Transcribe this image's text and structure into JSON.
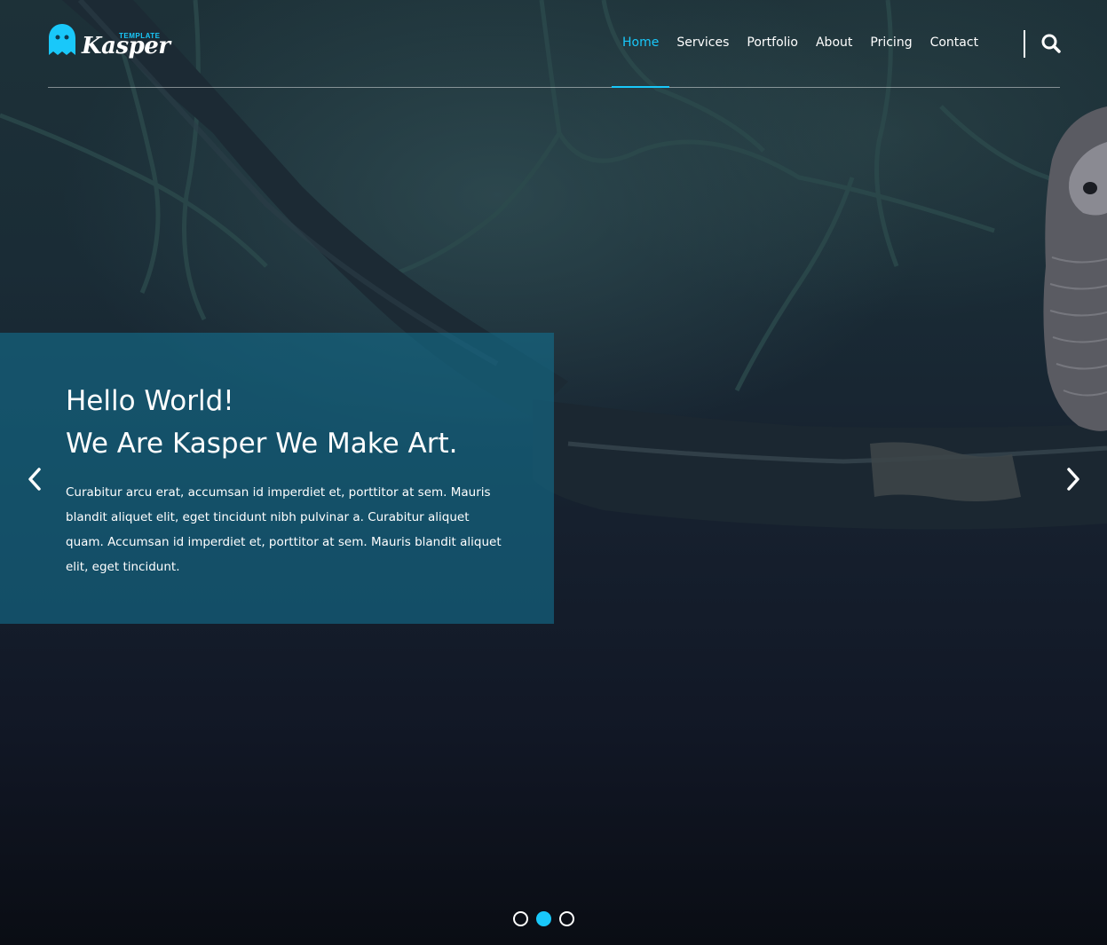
{
  "header": {
    "logo": {
      "tagline": "TEMPLATE",
      "wordmark": "Kasper"
    },
    "nav": [
      {
        "label": "Home",
        "active": true
      },
      {
        "label": "Services",
        "active": false
      },
      {
        "label": "Portfolio",
        "active": false
      },
      {
        "label": "About",
        "active": false
      },
      {
        "label": "Pricing",
        "active": false
      },
      {
        "label": "Contact",
        "active": false
      }
    ],
    "search_icon": "search-icon"
  },
  "hero": {
    "title_line1": "Hello World!",
    "title_line2": "We Are Kasper We Make Art.",
    "text": "Curabitur arcu erat, accumsan id imperdiet et, porttitor at sem. Mauris blandit aliquet elit, eget tincidunt nibh pulvinar a. Curabitur aliquet quam. Accumsan id imperdiet et, porttitor at sem. Mauris blandit aliquet elit, eget tincidunt.",
    "prev_icon": "chevron-left-icon",
    "next_icon": "chevron-right-icon",
    "slides_count": 3,
    "active_slide": 2
  },
  "colors": {
    "accent": "#19c8fa",
    "panel": "#146e8c",
    "text": "#ffffff"
  }
}
